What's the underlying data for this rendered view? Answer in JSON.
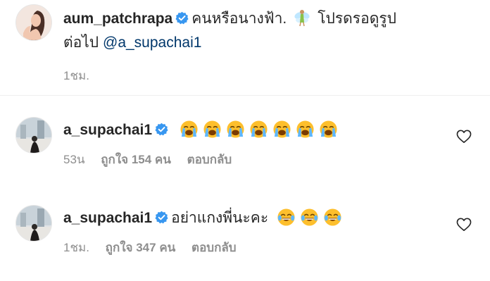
{
  "caption": {
    "username": "aum_patchrapa",
    "text_before": "คนหรือนางฟ้า.",
    "text_after": "โปรดรอดูรูป",
    "text_line2": "ต่อไป",
    "mention": "@a_supachai1",
    "time": "1ชม.",
    "icons": [
      "verified-badge-icon",
      "fairy-emoji-icon"
    ]
  },
  "comments": [
    {
      "username": "a_supachai1",
      "text": "",
      "emoji_count": 7,
      "emoji": "loudly-crying-face-icon",
      "time": "53น",
      "likes": "ถูกใจ 154 คน",
      "reply": "ตอบกลับ"
    },
    {
      "username": "a_supachai1",
      "text": "อย่าแกงพี่นะคะ",
      "emoji_count": 3,
      "emoji": "tears-of-joy-face-icon",
      "time": "1ชม.",
      "likes": "ถูกใจ 347 คน",
      "reply": "ตอบกลับ"
    }
  ],
  "colors": {
    "verified": "#3897f0",
    "mention": "#00376b",
    "secondary_text": "#8e8e8e",
    "emoji_face": "#fdbf2d"
  }
}
